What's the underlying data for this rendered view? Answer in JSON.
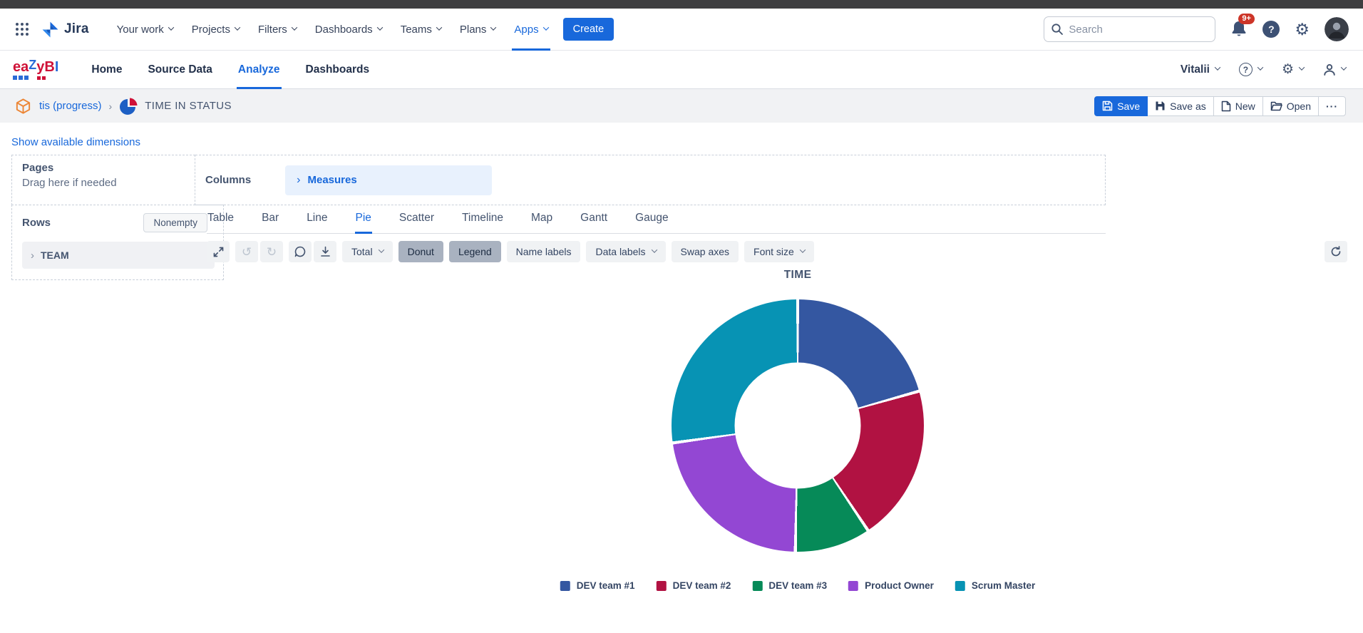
{
  "jira_nav": {
    "logo_text": "Jira",
    "items": [
      "Your work",
      "Projects",
      "Filters",
      "Dashboards",
      "Teams",
      "Plans",
      "Apps"
    ],
    "active_item": "Apps",
    "create_label": "Create",
    "search_placeholder": "Search",
    "notification_badge": "9+",
    "help_glyph": "?",
    "gear_glyph": "⚙"
  },
  "eazybi_nav": {
    "logo_red1": "ea",
    "logo_blue1": "Z",
    "logo_red2": "yB",
    "logo_blue2": "I",
    "items": [
      "Home",
      "Source Data",
      "Analyze",
      "Dashboards"
    ],
    "active_item": "Analyze",
    "user_name": "Vitalii",
    "help_glyph": "?",
    "gear_glyph": "⚙"
  },
  "breadcrumb": {
    "account_link": "tis (progress)",
    "separator": "›",
    "report_title": "TIME IN STATUS",
    "actions": [
      {
        "label": "Save",
        "icon": "save-outline",
        "primary": true
      },
      {
        "label": "Save as",
        "icon": "save-filled",
        "primary": false
      },
      {
        "label": "New",
        "icon": "document",
        "primary": false
      },
      {
        "label": "Open",
        "icon": "folder",
        "primary": false
      },
      {
        "label": "···",
        "icon": null,
        "primary": false
      }
    ]
  },
  "dimensions_link": "Show available dimensions",
  "pages_panel": {
    "label": "Pages",
    "hint": "Drag here if needed"
  },
  "columns_panel": {
    "label": "Columns",
    "member_chevron": "›",
    "member": "Measures"
  },
  "rows_panel": {
    "label": "Rows",
    "nonempty_label": "Nonempty",
    "member_chevron": "›",
    "member": "TEAM"
  },
  "chart_tabs": {
    "items": [
      "Table",
      "Bar",
      "Line",
      "Pie",
      "Scatter",
      "Timeline",
      "Map",
      "Gantt",
      "Gauge"
    ],
    "active": "Pie"
  },
  "toolbar": {
    "undo_glyph": "↺",
    "redo_glyph": "↻",
    "controls": [
      {
        "label": "Total",
        "caret": true,
        "active": false
      },
      {
        "label": "Donut",
        "caret": false,
        "active": true
      },
      {
        "label": "Legend",
        "caret": false,
        "active": true
      },
      {
        "label": "Name labels",
        "caret": false,
        "active": false
      },
      {
        "label": "Data labels",
        "caret": true,
        "active": false
      },
      {
        "label": "Swap axes",
        "caret": false,
        "active": false
      },
      {
        "label": "Font size",
        "caret": true,
        "active": false
      }
    ]
  },
  "colors": {
    "accent_blue": "#1868db",
    "crumb_bg": "#f1f2f4",
    "active_toolbar_bg": "#a9b2c0",
    "badge_red": "#cd3528"
  },
  "chart_data": {
    "type": "pie",
    "subtype": "donut",
    "title": "TIME",
    "donut_inner_ratio": 0.5,
    "start_angle_deg": 0,
    "legend_position": "bottom",
    "series": [
      {
        "name": "DEV team #1",
        "color": "#3457a1",
        "percent": 20.6
      },
      {
        "name": "DEV team #2",
        "color": "#b11242",
        "percent": 20.0
      },
      {
        "name": "DEV team #3",
        "color": "#068a58",
        "percent": 9.7
      },
      {
        "name": "Product Owner",
        "color": "#9347d3",
        "percent": 22.5
      },
      {
        "name": "Scrum Master",
        "color": "#0793b4",
        "percent": 27.2
      }
    ]
  }
}
